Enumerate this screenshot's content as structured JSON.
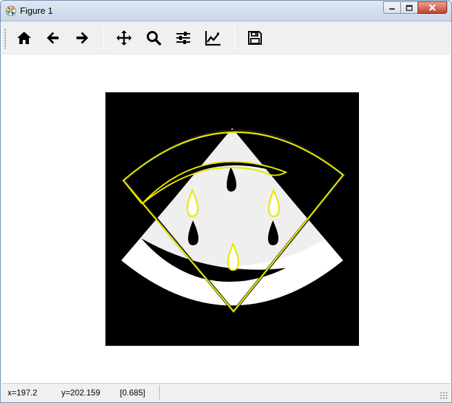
{
  "window": {
    "title": "Figure 1"
  },
  "toolbar": {
    "tools": [
      {
        "name": "home",
        "icon": "home-icon"
      },
      {
        "name": "back",
        "icon": "arrow-left-icon"
      },
      {
        "name": "forward",
        "icon": "arrow-right-icon"
      },
      {
        "name": "pan",
        "icon": "move-icon"
      },
      {
        "name": "zoom",
        "icon": "zoom-icon"
      },
      {
        "name": "subplots",
        "icon": "sliders-icon"
      },
      {
        "name": "customize",
        "icon": "chart-line-icon"
      },
      {
        "name": "save",
        "icon": "floppy-disk-icon"
      }
    ]
  },
  "figure": {
    "image_description_colors": {
      "background": "#000000",
      "fruit": "#f0f0f0",
      "rind": "#ffffff",
      "contour": "#e6e600"
    }
  },
  "statusbar": {
    "x_readout": "x=197.2",
    "y_readout": "y=202.159",
    "value_readout": "[0.685]"
  },
  "colors": {
    "titlebar": "#c9d7e6",
    "toolbar": "#f0f0f0",
    "close_button": "#c4412a"
  }
}
